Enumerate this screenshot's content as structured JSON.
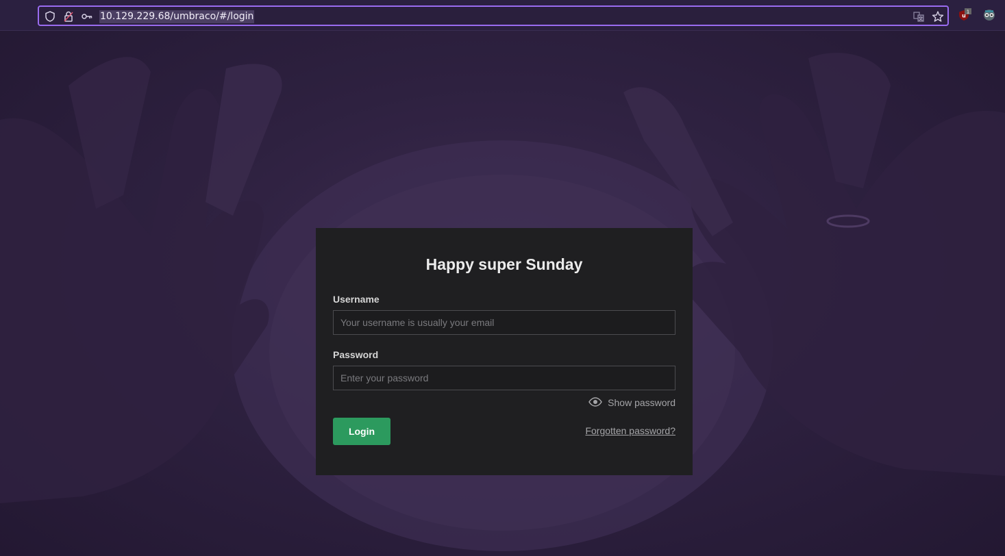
{
  "browser": {
    "url": "10.129.229.68/umbraco/#/login",
    "icons": [
      "shield-icon",
      "lock-icon",
      "key-icon",
      "translate-icon",
      "bookmark-star-icon",
      "ublock-extension-icon",
      "extension-icon"
    ],
    "ublock_badge": "1",
    "accent": "#9a6cf0"
  },
  "login": {
    "greeting": "Happy super Sunday",
    "username_label": "Username",
    "username_placeholder": "Your username is usually your email",
    "username_value": "",
    "password_label": "Password",
    "password_placeholder": "Enter your password",
    "password_value": "",
    "show_password_label": "Show password",
    "login_button": "Login",
    "forgot_link": "Forgotten password?",
    "button_color": "#2c9a5e"
  }
}
